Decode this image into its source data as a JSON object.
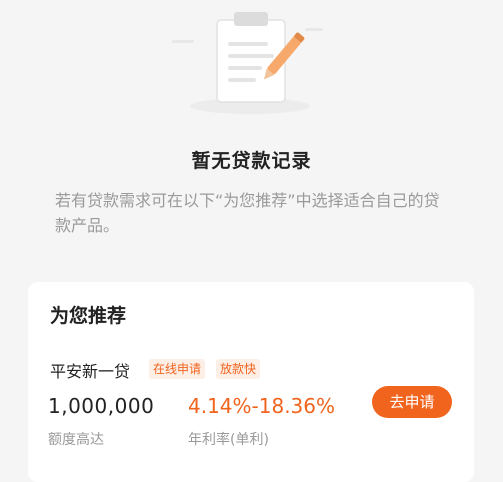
{
  "colors": {
    "accent": "#f0641e",
    "accent_tag_bg": "#fdeee6",
    "page_bg": "#f5f5f5",
    "title_text": "#222222",
    "secondary_text": "#9a9a9a"
  },
  "empty_state": {
    "icon": "clipboard-with-pencil-icon",
    "title": "暂无贷款记录",
    "description": "若有贷款需求可在以下“为您推荐”中选择适合自己的贷款产品。"
  },
  "recommend": {
    "title": "为您推荐",
    "product": {
      "name": "平安新一贷",
      "tags": [
        "在线申请",
        "放款快"
      ],
      "amount": "1,000,000",
      "amount_label": "额度高达",
      "rate": "4.14%-18.36%",
      "rate_label": "年利率(单利)",
      "apply_label": "去申请"
    }
  }
}
